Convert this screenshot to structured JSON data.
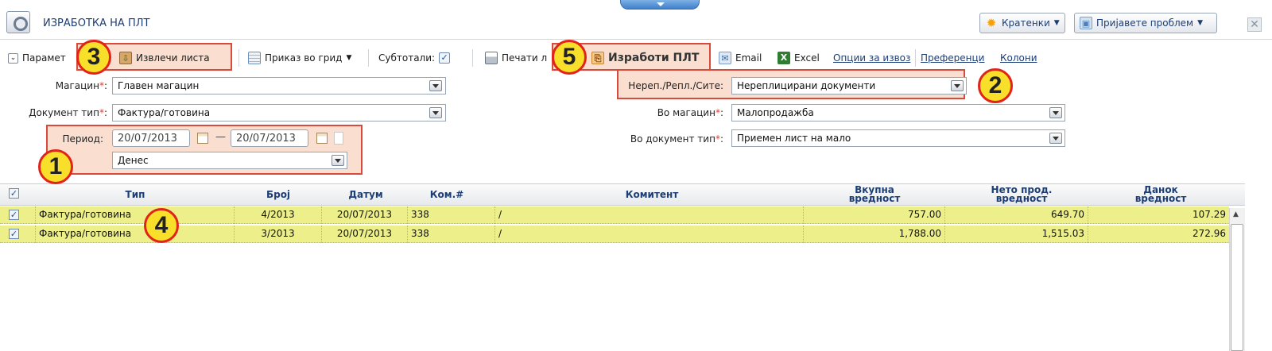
{
  "window": {
    "title": "ИЗРАБОТКА НА ПЛТ",
    "buttons": {
      "shortcuts": "Кратенки",
      "report_problem": "Пријавете проблем"
    }
  },
  "toolbar": {
    "parameters": "Парамет",
    "extract_lists": "Извлечи листа",
    "grid_view": "Приказ во грид",
    "subtotals": "Субтотали:",
    "print": "Печати л",
    "create_plt": "Изработи ПЛТ",
    "email": "Email",
    "excel": "Excel",
    "export_options": "Опции за извоз",
    "preferences": "Преференци",
    "columns": "Колони"
  },
  "form": {
    "warehouse": {
      "label": "Магацин",
      "value": "Главен магацин"
    },
    "doc_type": {
      "label": "Документ тип",
      "value": "Фактура/готовина"
    },
    "period": {
      "label": "Период:",
      "from": "20/07/2013",
      "to": "20/07/2013",
      "dash": "—",
      "preset": "Денес"
    },
    "replication": {
      "label": "Нереп./Репл./Сите:",
      "value": "Нереплицирани документи"
    },
    "to_warehouse": {
      "label": "Во магацин",
      "value": "Малопродажба"
    },
    "to_doc_type": {
      "label": "Во документ тип",
      "value": "Приемен лист на мало"
    },
    "required_mark": "*"
  },
  "grid": {
    "headers": {
      "type": "Тип",
      "number": "Број",
      "date": "Датум",
      "com": "Ком.#",
      "client": "Комитент",
      "total_1": "Вкупна",
      "total_2": "вредност",
      "net_1": "Нето прод.",
      "net_2": "вредност",
      "tax_1": "Данок",
      "tax_2": "вредност"
    },
    "rows": [
      {
        "type": "Фактура/готовина",
        "number": "4/2013",
        "date": "20/07/2013",
        "com": "338",
        "client": "/",
        "total": "757.00",
        "net": "649.70",
        "tax": "107.29"
      },
      {
        "type": "Фактура/готовина",
        "number": "3/2013",
        "date": "20/07/2013",
        "com": "338",
        "client": "/",
        "total": "1,788.00",
        "net": "1,515.03",
        "tax": "272.96"
      }
    ]
  },
  "callouts": [
    "1",
    "2",
    "3",
    "4",
    "5"
  ],
  "colors": {
    "highlight_row": "#edf08a",
    "callout_fill": "#f7df2a",
    "callout_border": "#e2231a",
    "header_text": "#1d3e74"
  }
}
